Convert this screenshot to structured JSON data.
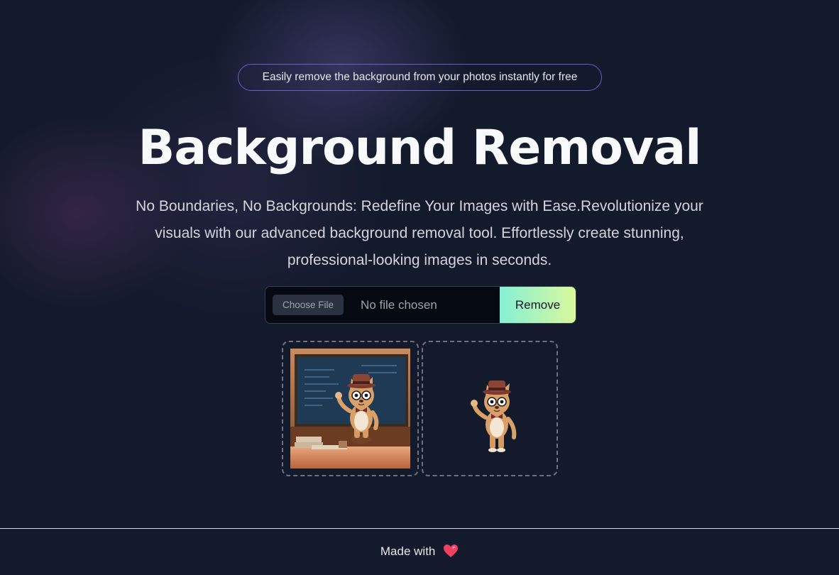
{
  "badge": {
    "text": "Easily remove the background from your photos instantly for free"
  },
  "hero": {
    "title": "Background Removal",
    "description": "No Boundaries, No Backgrounds: Redefine Your Images with Ease.Revolutionize your visuals with our advanced background removal tool. Effortlessly create stunning, professional-looking images in seconds."
  },
  "upload": {
    "choose_label": "Choose File",
    "status": "No file chosen",
    "remove_label": "Remove"
  },
  "footer": {
    "text": "Made with",
    "icon": "heart-icon"
  },
  "colors": {
    "badge_border": "#6d5bd0",
    "remove_gradient_start": "#86efd4",
    "remove_gradient_end": "#d9f99d",
    "heart": "#f43f5e"
  }
}
